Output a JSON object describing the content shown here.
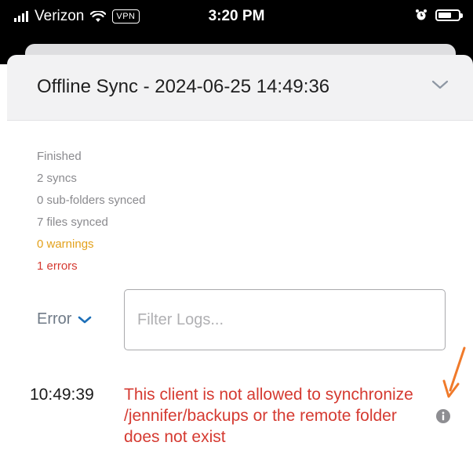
{
  "status_bar": {
    "carrier": "Verizon",
    "vpn": "VPN",
    "time": "3:20 PM"
  },
  "header": {
    "title": "Offline Sync - 2024-06-25 14:49:36"
  },
  "summary": {
    "status": "Finished",
    "syncs": "2 syncs",
    "subfolders": "0 sub-folders synced",
    "files": "7 files synced",
    "warnings": "0 warnings",
    "errors": "1 errors"
  },
  "filters": {
    "level_label": "Error",
    "search_placeholder": "Filter Logs..."
  },
  "logs": [
    {
      "time": "10:49:39",
      "message": "This client is not allowed to synchronize /jennifer/backups or the remote folder does not exist"
    }
  ],
  "colors": {
    "warning": "#e3a11b",
    "error": "#d53a31",
    "accent": "#1d6fb8",
    "annotation_arrow": "#f07a2a"
  },
  "icons": [
    "signal-icon",
    "wifi-icon",
    "alarm-icon",
    "battery-icon",
    "chevron-down-icon",
    "info-icon",
    "annotation-arrow"
  ]
}
